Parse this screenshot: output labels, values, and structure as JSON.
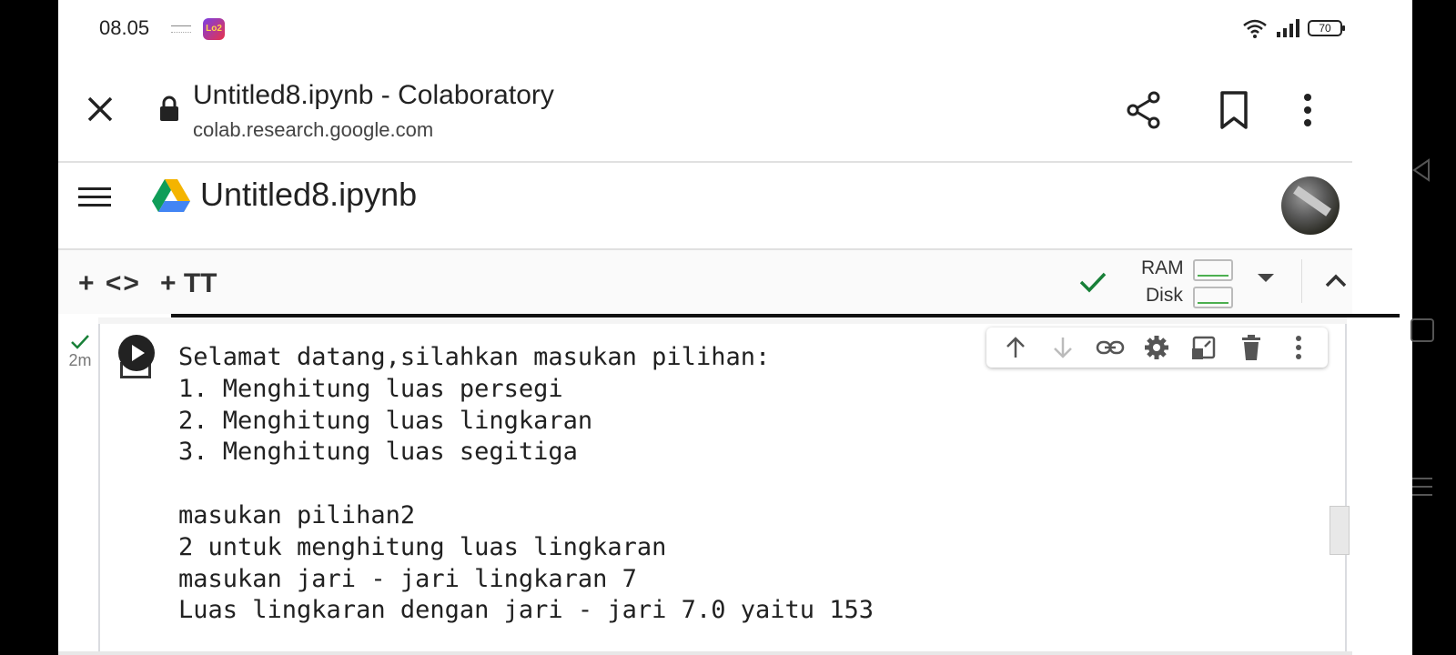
{
  "status_bar": {
    "time": "08.05",
    "battery_level": "70",
    "app_icon_2_label": "Lo2"
  },
  "browser_tab": {
    "title": "Untitled8.ipynb - Colaboratory",
    "url": "colab.research.google.com"
  },
  "colab_header": {
    "notebook_title": "Untitled8.ipynb"
  },
  "toolbar": {
    "add_code_label": "+ <>",
    "add_text_label": "+ TT",
    "ram_label": "RAM",
    "disk_label": "Disk"
  },
  "cell": {
    "exec_time": "2m",
    "output_lines": [
      "Selamat datang,silahkan masukan pilihan:",
      "1. Menghitung luas persegi",
      "2. Menghitung luas lingkaran",
      "3. Menghitung luas segitiga",
      "",
      "masukan pilihan2",
      "2 untuk menghitung luas lingkaran",
      "masukan jari - jari lingkaran 7",
      "Luas lingkaran dengan jari - jari 7.0 yaitu 153"
    ]
  },
  "colors": {
    "check_green": "#188038",
    "drive_green": "#0f9d58",
    "drive_yellow": "#f4b400",
    "drive_blue": "#4285f4"
  },
  "icons": [
    "close-icon",
    "lock-icon",
    "share-icon",
    "bookmark-icon",
    "more-vert-icon",
    "hamburger-icon",
    "drive-logo",
    "check-icon",
    "arrow-up-icon",
    "arrow-down-icon",
    "link-icon",
    "gear-icon",
    "mirror-cell-icon",
    "trash-icon"
  ]
}
